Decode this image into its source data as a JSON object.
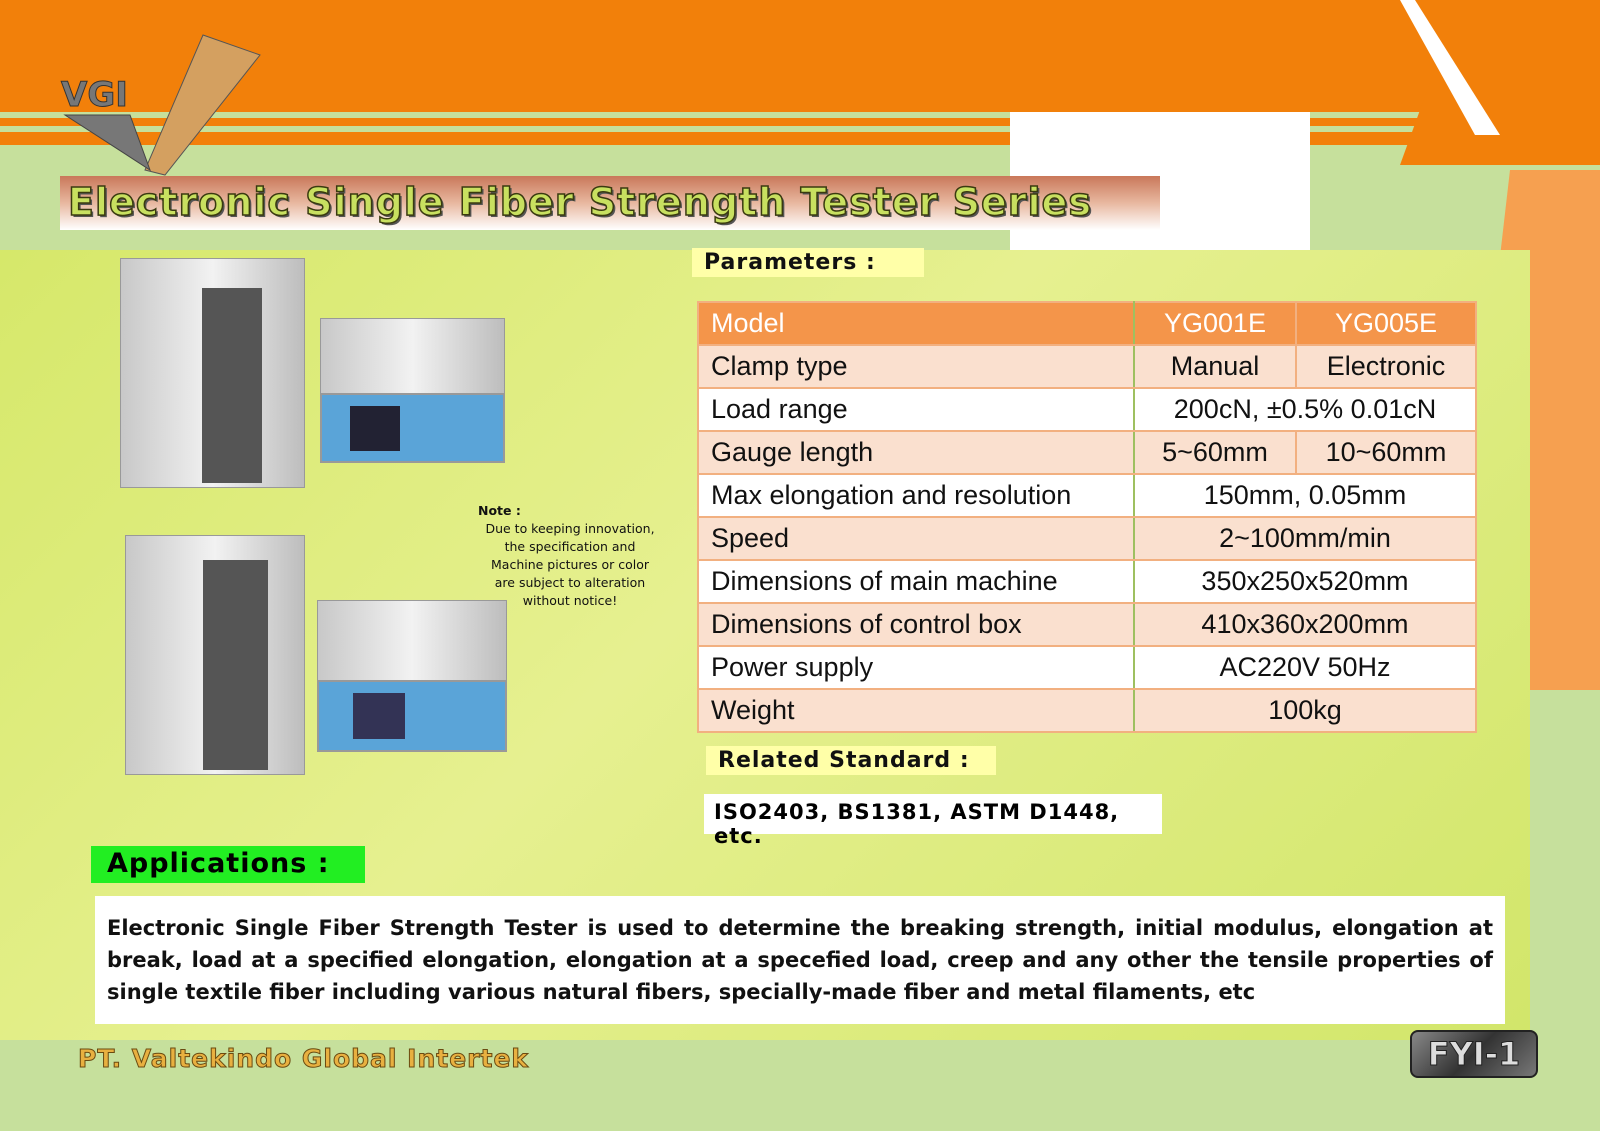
{
  "logo": {
    "text": "VGI"
  },
  "title": "Electronic Single Fiber Strength Tester Series",
  "note": {
    "heading": "Note :",
    "lines": [
      "Due to keeping innovation,",
      "the specification and",
      "Machine pictures or color",
      "are subject to alteration",
      "without notice!"
    ]
  },
  "parameters": {
    "heading": "Parameters :",
    "header": [
      "Model",
      "YG001E",
      "YG005E"
    ],
    "rows": [
      {
        "label": "Clamp type",
        "v1": "Manual",
        "v2": "Electronic"
      },
      {
        "label": "Load range",
        "v": "200cN, ±0.5% 0.01cN"
      },
      {
        "label": "Gauge length",
        "v1": "5~60mm",
        "v2": "10~60mm"
      },
      {
        "label": "Max elongation and resolution",
        "v": "150mm, 0.05mm"
      },
      {
        "label": "Speed",
        "v": "2~100mm/min"
      },
      {
        "label": "Dimensions of main machine",
        "v": "350x250x520mm"
      },
      {
        "label": "Dimensions of control box",
        "v": "410x360x200mm"
      },
      {
        "label": "Power supply",
        "v": "AC220V 50Hz"
      },
      {
        "label": "Weight",
        "v": "100kg"
      }
    ]
  },
  "standard": {
    "heading": "Related Standard :",
    "value": "ISO2403, BS1381, ASTM D1448, etc."
  },
  "applications": {
    "heading": "Applications :",
    "text": "Electronic Single Fiber Strength Tester is used to determine the breaking strength, initial modulus, elongation at break, load at a specified elongation, elongation at a specefied load, creep and any other  the tensile properties of single textile fiber including various natural fibers, specially-made fiber and metal filaments, etc"
  },
  "footer": {
    "company": "PT. Valtekindo Global Intertek",
    "badge": "FYI-1"
  },
  "colors": {
    "orange": "#f2800a",
    "table_header": "#f4954a",
    "lime": "#d4e86a",
    "green_label": "#22ee22"
  }
}
